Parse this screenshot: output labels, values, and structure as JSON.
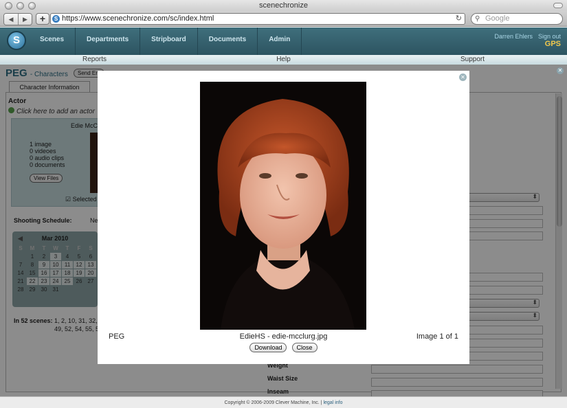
{
  "browser": {
    "window_title": "scenechronize",
    "back_icon": "◀",
    "forward_icon": "▶",
    "new_tab_icon": "+",
    "url": "https://www.scenechronize.com/sc/index.html",
    "reload_icon": "↻",
    "search_placeholder": "Google"
  },
  "app": {
    "logo_letter": "S",
    "nav": [
      "Scenes",
      "Departments",
      "Stripboard",
      "Documents",
      "Admin"
    ],
    "user": "Darren Ehlers",
    "sign_out": "Sign out",
    "badge": "GPS",
    "subnav": [
      "Reports",
      "Help",
      "Support"
    ]
  },
  "page": {
    "title": "PEG",
    "subtitle": "- Characters",
    "send_label": "Send Em",
    "tab": "Character Information",
    "actor_heading": "Actor",
    "add_actor": "Click here to add an actor",
    "actor_name": "Edie McCl",
    "stats": [
      "1 image",
      "0 videoes",
      "0 audio clips",
      "0 documents"
    ],
    "view_files": "View Files",
    "selected": "Selected",
    "shooting_label": "Shooting Schedule:",
    "shooting_value": "Ne",
    "calendar": {
      "month": "Mar 2010",
      "prev_icon": "◀",
      "dows": [
        "S",
        "M",
        "T",
        "W",
        "T",
        "F",
        "S"
      ],
      "days": [
        "",
        "1",
        "2",
        "3",
        "4",
        "5",
        "6",
        "7",
        "8",
        "9",
        "10",
        "11",
        "12",
        "13",
        "14",
        "15",
        "16",
        "17",
        "18",
        "19",
        "20",
        "21",
        "22",
        "23",
        "24",
        "25",
        "26",
        "27",
        "28",
        "29",
        "30",
        "31",
        "",
        "",
        ""
      ]
    },
    "in_scenes_label": "In 52 scenes:",
    "in_scenes_line1": "1, 2, 10, 31, 32,",
    "in_scenes_line2": "49, 52, 54, 55, 5",
    "labels": [
      "Weight",
      "Waist Size",
      "Inseam"
    ]
  },
  "modal": {
    "left": "PEG",
    "caption": "EdieHS - edie-mcclurg.jpg",
    "counter": "Image 1 of 1",
    "download": "Download",
    "close": "Close",
    "close_icon": "✕"
  },
  "footer": {
    "copyright": "Copyright © 2006-2009 Clever Machine, Inc. |",
    "legal": "legal info"
  }
}
